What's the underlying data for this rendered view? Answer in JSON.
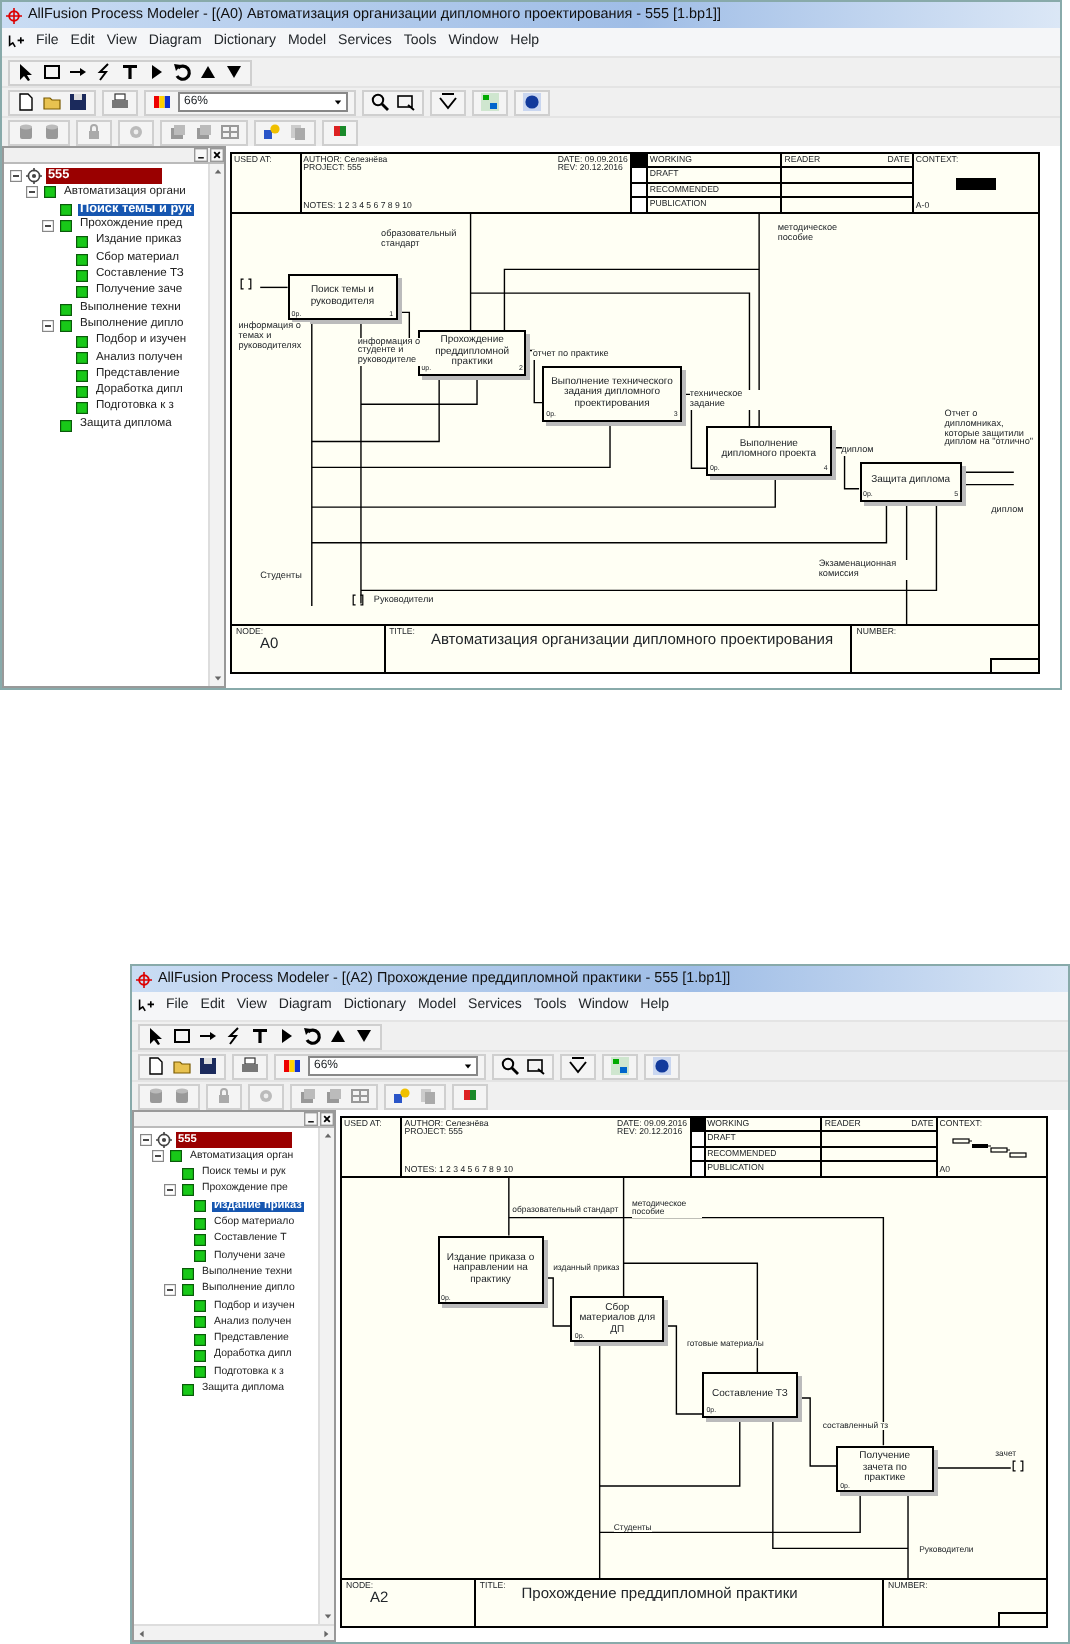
{
  "windows": [
    {
      "title": "AllFusion Process Modeler - [(A0) Автоматизация организации дипломного проектирования - 555 [1.bp1]]",
      "menu": [
        "File",
        "Edit",
        "View",
        "Diagram",
        "Dictionary",
        "Model",
        "Services",
        "Tools",
        "Window",
        "Help"
      ],
      "zoom": "66%",
      "tree": [
        {
          "label": "555",
          "kind": "model",
          "selected": false,
          "expanded": true,
          "children": [
            {
              "label": "Автоматизация органи",
              "kind": "process",
              "selected": false,
              "expanded": true,
              "children": [
                {
                  "label": "Поиск темы и рук",
                  "kind": "process",
                  "selected": true
                },
                {
                  "label": "Прохождение пред",
                  "kind": "process",
                  "selected": false,
                  "expanded": true,
                  "children": [
                    {
                      "label": "Издание приказ",
                      "kind": "process",
                      "selected": false
                    },
                    {
                      "label": "Сбор материал",
                      "kind": "process",
                      "selected": false
                    },
                    {
                      "label": "Составление ТЗ",
                      "kind": "process",
                      "selected": false
                    },
                    {
                      "label": "Получение заче",
                      "kind": "process",
                      "selected": false
                    }
                  ]
                },
                {
                  "label": "Выполнение техни",
                  "kind": "process",
                  "selected": false
                },
                {
                  "label": "Выполнение дипло",
                  "kind": "process",
                  "selected": false,
                  "expanded": true,
                  "children": [
                    {
                      "label": "Подбор и изучен",
                      "kind": "process",
                      "selected": false
                    },
                    {
                      "label": "Анализ получен",
                      "kind": "process",
                      "selected": false
                    },
                    {
                      "label": "Представление",
                      "kind": "process",
                      "selected": false
                    },
                    {
                      "label": "Доработка дипл",
                      "kind": "process",
                      "selected": false
                    },
                    {
                      "label": "Подготовка к з",
                      "kind": "process",
                      "selected": false
                    }
                  ]
                },
                {
                  "label": "Защита диплома",
                  "kind": "process",
                  "selected": false
                }
              ]
            }
          ]
        }
      ],
      "diagram": {
        "header": {
          "used_at": "USED AT:",
          "author": "AUTHOR: Селезнёва",
          "project": "PROJECT: 555",
          "notes": "NOTES: 1 2 3 4 5 6 7 8 9 10",
          "date": "DATE: 09.09.2016",
          "rev": "REV: 20.12.2016",
          "statuses": [
            {
              "label": "WORKING",
              "selected": true
            },
            {
              "label": "DRAFT",
              "selected": false
            },
            {
              "label": "RECOMMENDED",
              "selected": false
            },
            {
              "label": "PUBLICATION",
              "selected": false
            }
          ],
          "reader": "READER",
          "reader_date": "DATE",
          "context": {
            "label": "CONTEXT:",
            "node": "A-0",
            "kind": "top"
          }
        },
        "boxes": [
          {
            "label": "Поиск темы и руководителя",
            "cost": "0р.",
            "number": "1"
          },
          {
            "label": "Прохождение преддипломной практики",
            "cost": "0р.",
            "number": "2"
          },
          {
            "label": "Выполнение технического задания дипломного проектирования",
            "cost": "0р.",
            "number": "3"
          },
          {
            "label": "Выполнение дипломного проекта",
            "cost": "0р.",
            "number": "4"
          },
          {
            "label": "Защита диплома",
            "cost": "0р.",
            "number": "5"
          }
        ],
        "arrow_labels": [
          "образовательный стандарт",
          "методическое пособие",
          "информация о темах и руководителях",
          "информация о студенте и руководителе",
          "отчет по практике",
          "техническое задание",
          "диплом",
          "Отчет о дипломниках, которые защитили диплом на \"отлично\"",
          "диплом",
          "Экзаменационная комиссия",
          "Студенты",
          "Руководители"
        ],
        "footer": {
          "node_label": "NODE:",
          "node": "A0",
          "title_label": "TITLE:",
          "title": "Автоматизация организации дипломного проектирования",
          "number_label": "NUMBER:"
        }
      }
    },
    {
      "title": "AllFusion Process Modeler - [(A2) Прохождение преддипломной практики - 555 [1.bp1]]",
      "menu": [
        "File",
        "Edit",
        "View",
        "Diagram",
        "Dictionary",
        "Model",
        "Services",
        "Tools",
        "Window",
        "Help"
      ],
      "zoom": "66%",
      "tree": [
        {
          "label": "555",
          "kind": "model",
          "selected": false,
          "expanded": true,
          "children": [
            {
              "label": "Автоматизация орган",
              "kind": "process",
              "selected": false,
              "expanded": true,
              "children": [
                {
                  "label": "Поиск темы и рук",
                  "kind": "process",
                  "selected": false
                },
                {
                  "label": "Прохождение пре",
                  "kind": "process",
                  "selected": false,
                  "expanded": true,
                  "children": [
                    {
                      "label": "Издание приказ",
                      "kind": "process",
                      "selected": true
                    },
                    {
                      "label": "Сбор материало",
                      "kind": "process",
                      "selected": false
                    },
                    {
                      "label": "Составление Т",
                      "kind": "process",
                      "selected": false
                    },
                    {
                      "label": "Получени заче",
                      "kind": "process",
                      "selected": false
                    }
                  ]
                },
                {
                  "label": "Выполнение техни",
                  "kind": "process",
                  "selected": false
                },
                {
                  "label": "Выполнение дипло",
                  "kind": "process",
                  "selected": false,
                  "expanded": true,
                  "children": [
                    {
                      "label": "Подбор и изучен",
                      "kind": "process",
                      "selected": false
                    },
                    {
                      "label": "Анализ получен",
                      "kind": "process",
                      "selected": false
                    },
                    {
                      "label": "Представление",
                      "kind": "process",
                      "selected": false
                    },
                    {
                      "label": "Доработка дипл",
                      "kind": "process",
                      "selected": false
                    },
                    {
                      "label": "Подготовка к з",
                      "kind": "process",
                      "selected": false
                    }
                  ]
                },
                {
                  "label": "Защита диплома",
                  "kind": "process",
                  "selected": false
                }
              ]
            }
          ]
        }
      ],
      "diagram": {
        "header": {
          "used_at": "USED AT:",
          "author": "AUTHOR: Селезнёва",
          "project": "PROJECT: 555",
          "notes": "NOTES: 1 2 3 4 5 6 7 8 9 10",
          "date": "DATE: 09.09.2016",
          "rev": "REV: 20.12.2016",
          "statuses": [
            {
              "label": "WORKING",
              "selected": true
            },
            {
              "label": "DRAFT",
              "selected": false
            },
            {
              "label": "RECOMMENDED",
              "selected": false
            },
            {
              "label": "PUBLICATION",
              "selected": false
            }
          ],
          "reader": "READER",
          "reader_date": "DATE",
          "context": {
            "label": "CONTEXT:",
            "node": "A0",
            "kind": "child"
          }
        },
        "boxes": [
          {
            "label": "Издание приказа о направлении на практику",
            "cost": "0р."
          },
          {
            "label": "Сбор материалов для ДП",
            "cost": "0р."
          },
          {
            "label": "Составление ТЗ",
            "cost": "0р."
          },
          {
            "label": "Получение зачета по практике",
            "cost": "0р."
          }
        ],
        "arrow_labels": [
          "образовательный стандарт",
          "методическое пособие",
          "изданный приказ",
          "готовые материалы",
          "составленный тз",
          "зачет",
          "Студенты",
          "Руководители"
        ],
        "footer": {
          "node_label": "NODE:",
          "node": "A2",
          "title_label": "TITLE:",
          "title": "Прохождение преддипломной практики",
          "number_label": "NUMBER:"
        }
      }
    }
  ]
}
